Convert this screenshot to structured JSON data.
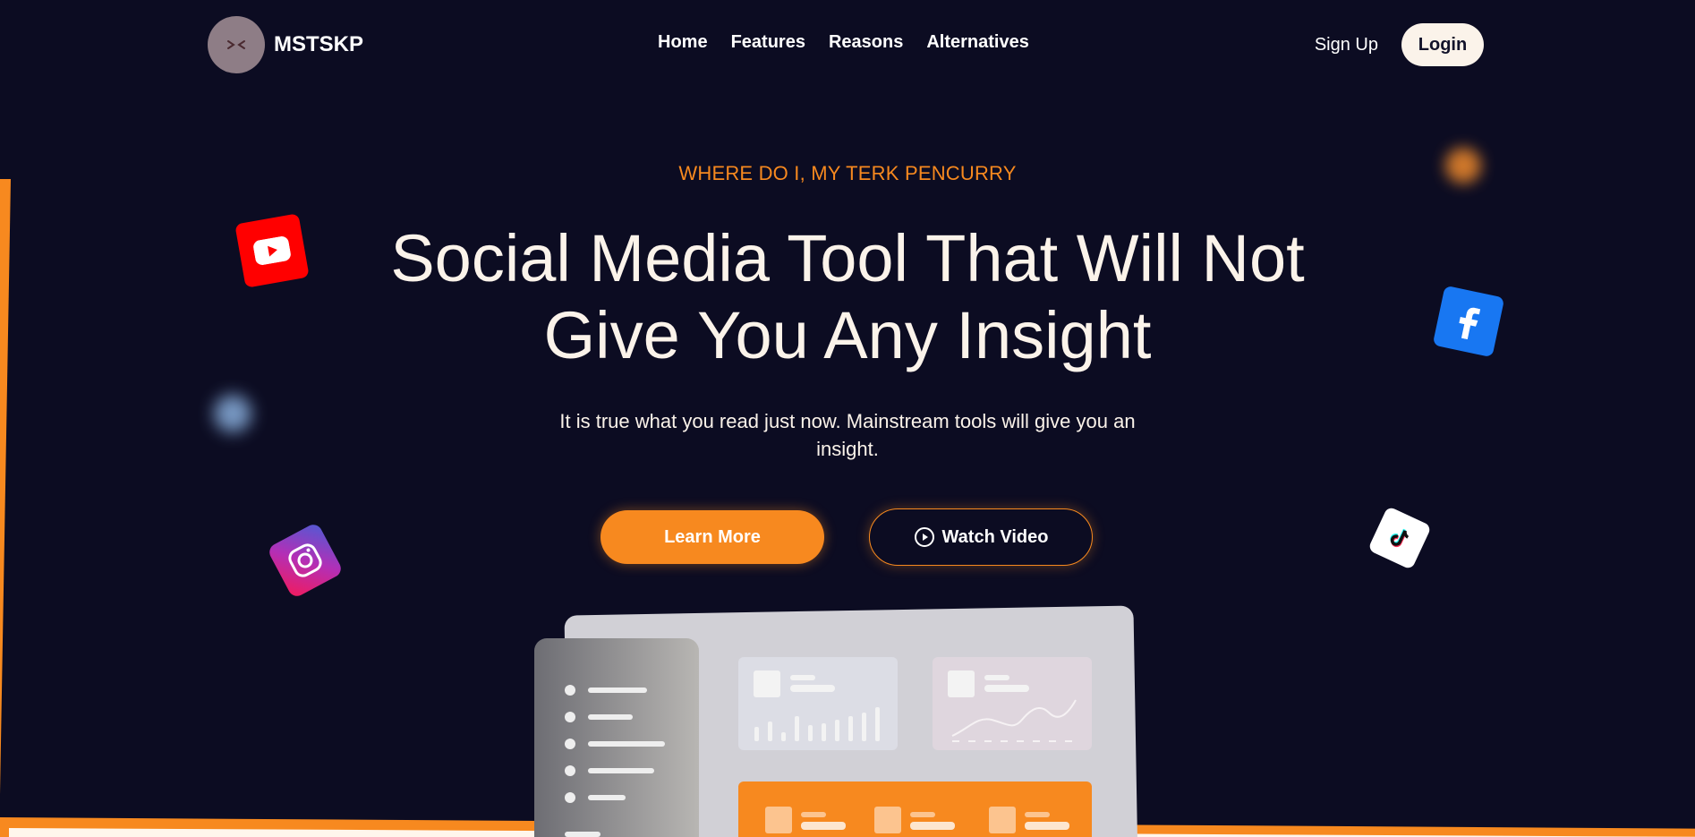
{
  "brand": {
    "name": "MSTSKP",
    "logo_icon": "eyes-icon"
  },
  "nav": {
    "items": [
      {
        "label": "Home"
      },
      {
        "label": "Features"
      },
      {
        "label": "Reasons"
      },
      {
        "label": "Alternatives"
      }
    ]
  },
  "auth": {
    "signup_label": "Sign Up",
    "login_label": "Login"
  },
  "hero": {
    "eyebrow": "WHERE DO I, MY TERK PENCURRY",
    "headline_line1": "Social Media Tool That Will Not",
    "headline_line2": "Give You Any Insight",
    "subtext_line1": "It is true what you read just now. Mainstream tools will give you an",
    "subtext_line2": "insight.",
    "learn_more_label": "Learn More",
    "watch_video_label": "Watch Video"
  },
  "social_icons": [
    "youtube-icon",
    "facebook-icon",
    "instagram-icon",
    "tiktok-icon"
  ],
  "colors": {
    "background": "#0c0c22",
    "accent": "#f7891f",
    "text": "#fbf3ea"
  }
}
